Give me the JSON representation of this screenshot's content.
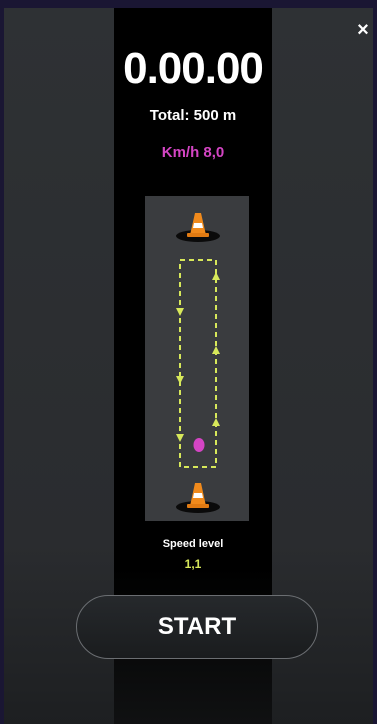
{
  "header": {
    "close_label": "×",
    "close_icon": "close-icon"
  },
  "stats": {
    "timer": "0.00.00",
    "total": "Total:  500 m",
    "speed_kmh": "Km/h 8,0"
  },
  "track": {
    "cone_icon": "traffic-cone-icon",
    "runner_icon": "runner-dot-icon",
    "path_color": "#d7e85a",
    "runner_color": "#d445c4",
    "cone_color": "#f08a1c"
  },
  "speed_level": {
    "label": "Speed level",
    "value": "1,1"
  },
  "actions": {
    "start_label": "START"
  },
  "colors": {
    "accent_magenta": "#d445c4",
    "accent_lime": "#d7e85a",
    "background": "#000000"
  }
}
